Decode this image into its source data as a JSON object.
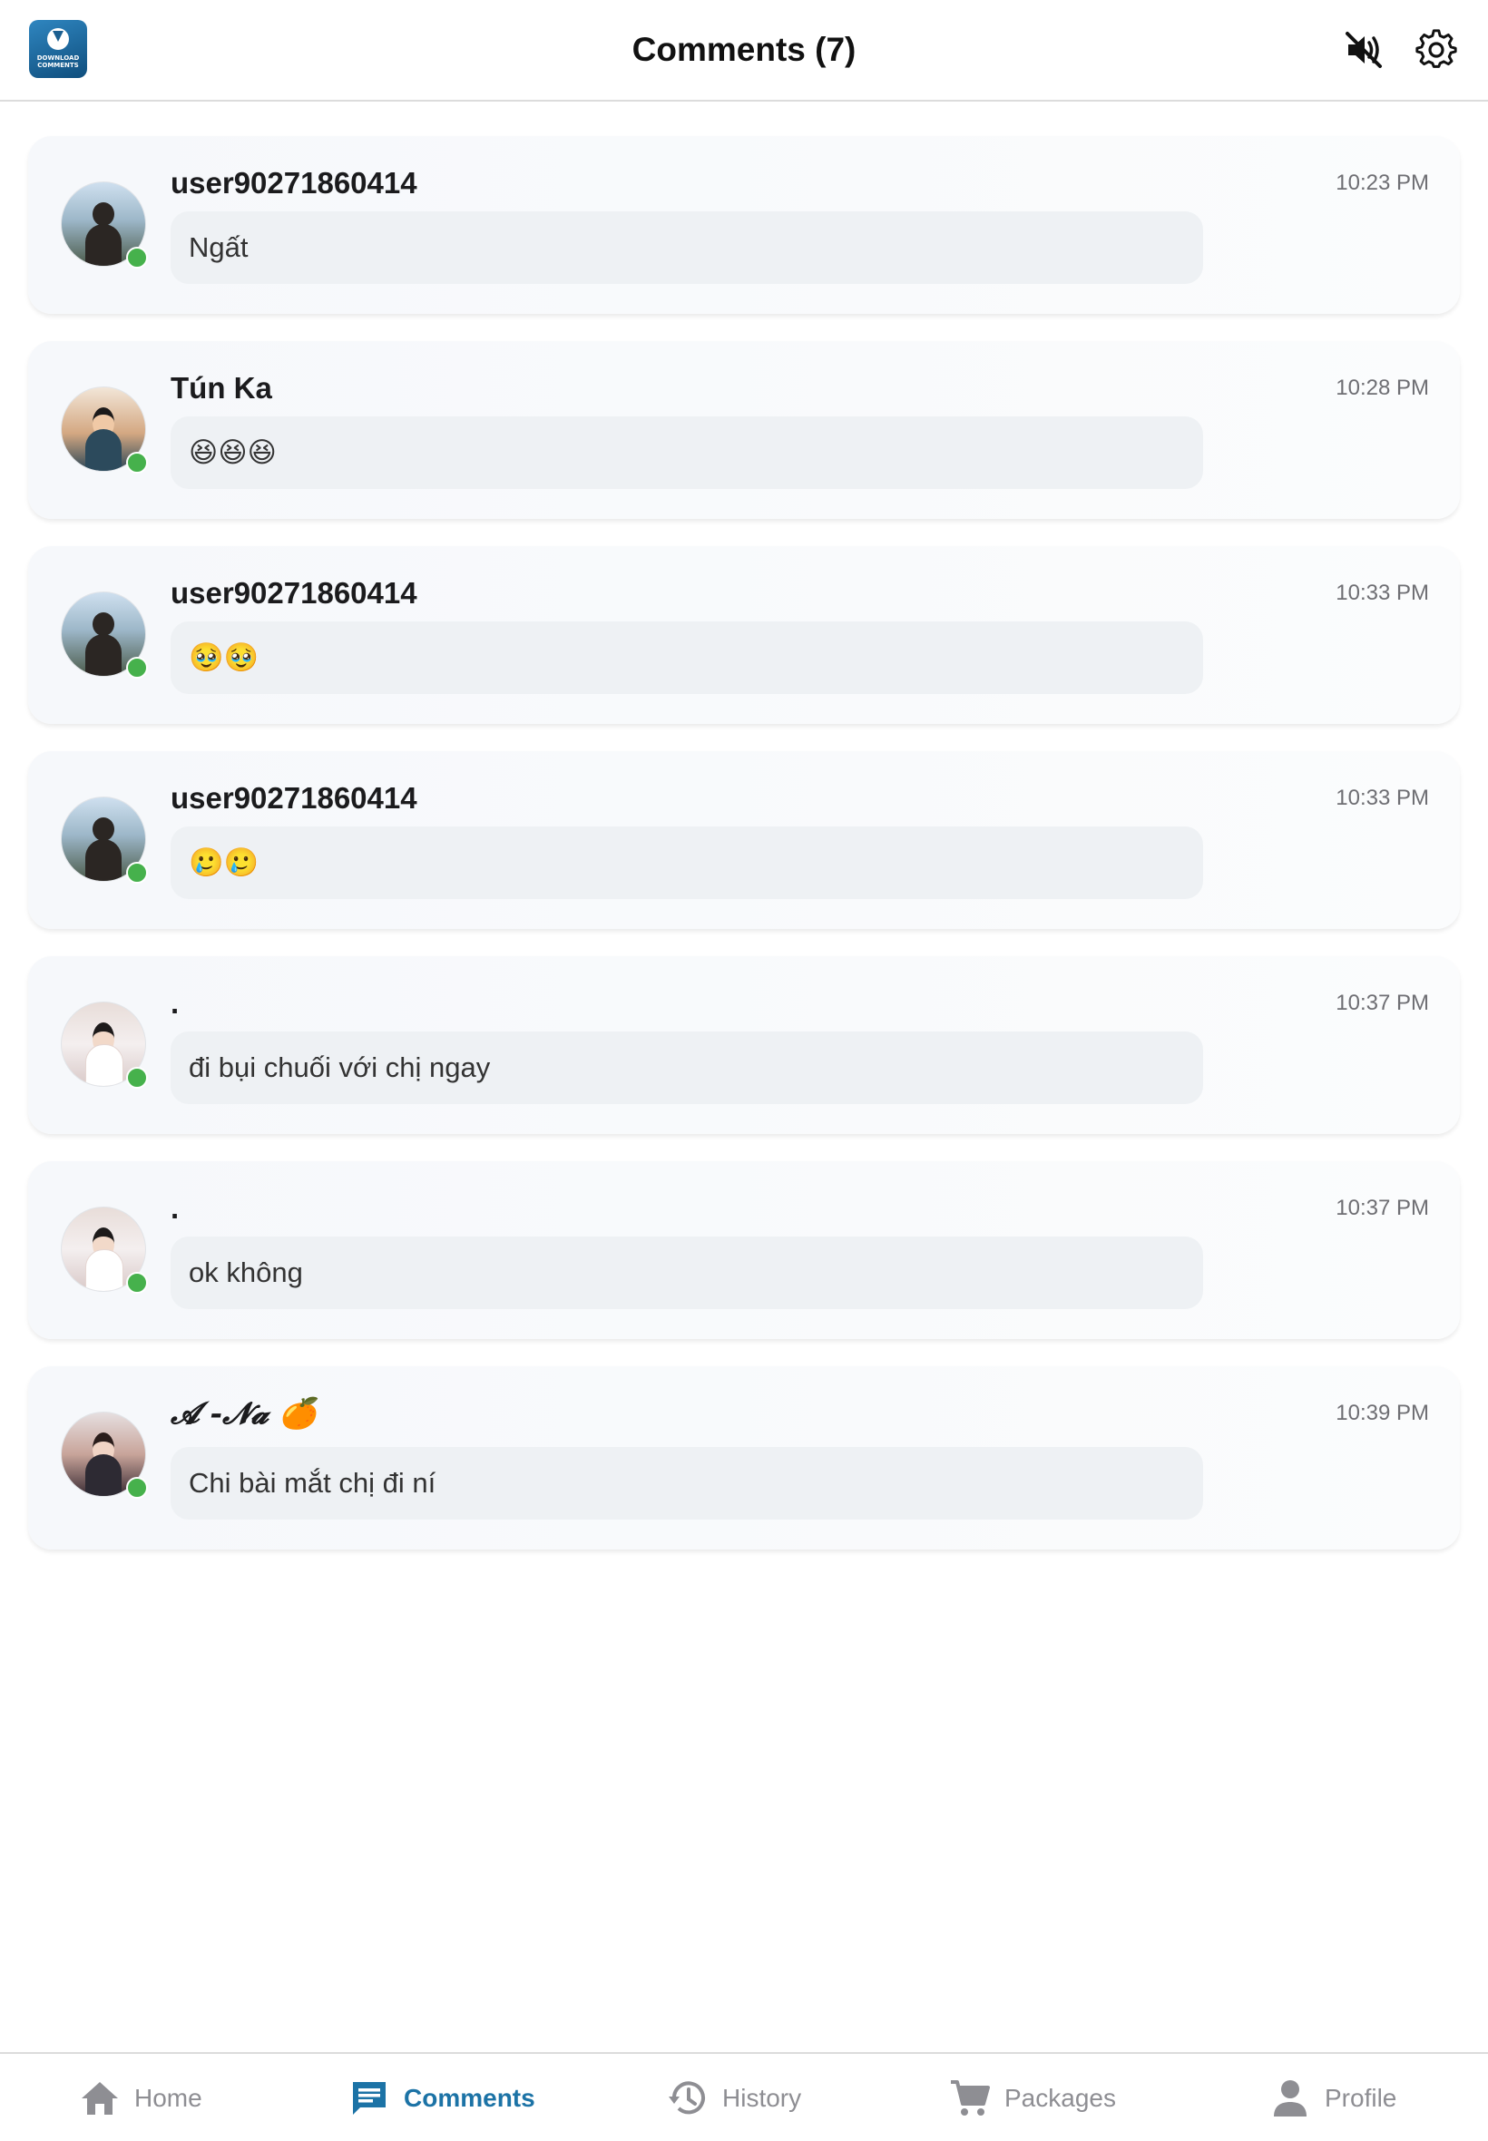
{
  "header": {
    "title": "Comments (7)",
    "logo_text": "DOWNLOAD COMMENTS",
    "mute_icon": "speaker-muted-icon",
    "settings_icon": "gear-icon"
  },
  "comments": [
    {
      "username": "user90271860414",
      "time": "10:23 PM",
      "text": "Ngất"
    },
    {
      "username": "Tún Ka",
      "time": "10:28 PM",
      "text": "😆😆😆"
    },
    {
      "username": "user90271860414",
      "time": "10:33 PM",
      "text": "🥹🥹"
    },
    {
      "username": "user90271860414",
      "time": "10:33 PM",
      "text": "🥲🥲"
    },
    {
      "username": ".",
      "time": "10:37 PM",
      "text": "đi bụi chuối với chị ngay"
    },
    {
      "username": ".",
      "time": "10:37 PM",
      "text": "ok không"
    },
    {
      "username": "𝓐 -𝓝𝓪 🍊",
      "time": "10:39 PM",
      "text": "Chi bài mắt chị đi ní"
    }
  ],
  "tabs": {
    "home": "Home",
    "comments": "Comments",
    "history": "History",
    "packages": "Packages",
    "profile": "Profile",
    "active": "comments"
  },
  "colors": {
    "accent": "#1c73a6",
    "online": "#46b14c",
    "tab_inactive": "#8e8e93",
    "bubble": "#eef1f4"
  }
}
